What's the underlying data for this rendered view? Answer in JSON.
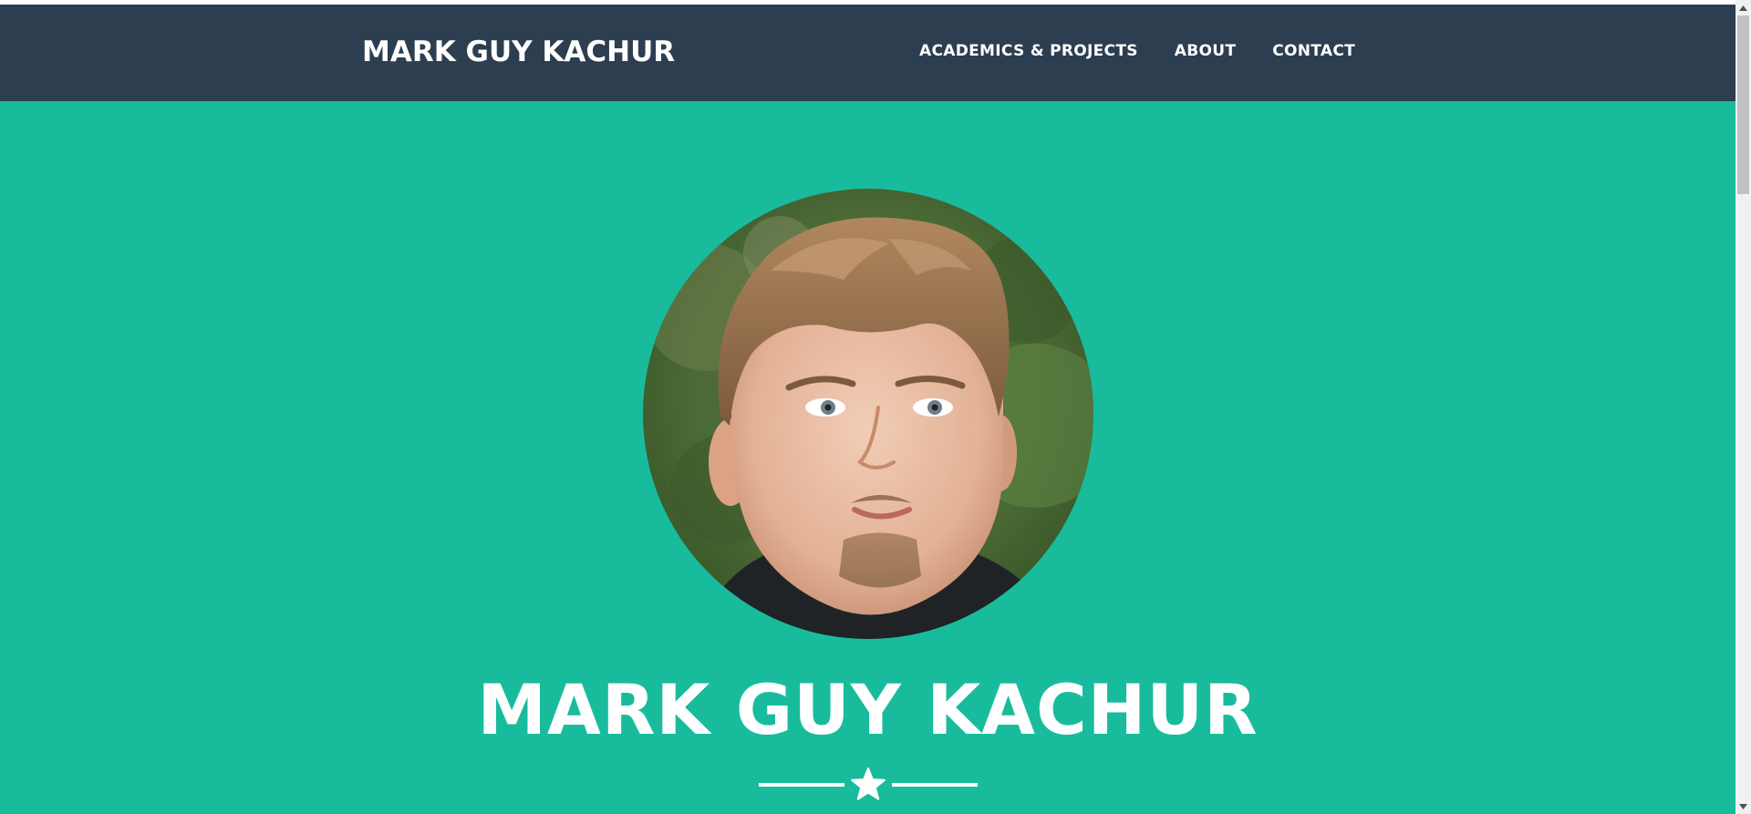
{
  "navbar": {
    "brand": "MARK GUY KACHUR",
    "links": [
      {
        "label": "ACADEMICS & PROJECTS"
      },
      {
        "label": "ABOUT"
      },
      {
        "label": "CONTACT"
      }
    ]
  },
  "masthead": {
    "title": "MARK GUY KACHUR",
    "divider_icon": "star-icon"
  },
  "colors": {
    "navbar_bg": "#2c3e50",
    "masthead_bg": "#18bc9c",
    "text": "#ffffff"
  }
}
